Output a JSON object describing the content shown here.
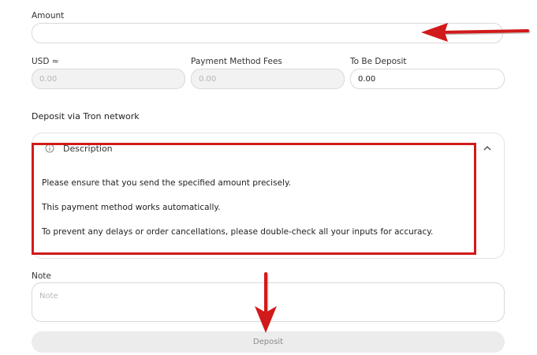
{
  "amount": {
    "label": "Amount",
    "value": ""
  },
  "conversion": {
    "usd_label": "USD ≈",
    "usd_value": "0.00",
    "fees_label": "Payment Method Fees",
    "fees_value": "0.00",
    "to_be_label": "To Be Deposit",
    "to_be_value": "0.00"
  },
  "network_title": "Deposit via Tron network",
  "description": {
    "header": "Description",
    "icon": "info-icon",
    "lines": [
      "Please ensure that you send the specified amount precisely.",
      "This payment method works automatically.",
      "To prevent any delays or order cancellations, please double-check all your inputs for accuracy."
    ]
  },
  "note": {
    "label": "Note",
    "placeholder": "Note"
  },
  "deposit_button": "Deposit",
  "colors": {
    "annotation_red": "#d11a1a",
    "disabled_bg": "#f2f2f2",
    "button_bg": "#ececec"
  }
}
